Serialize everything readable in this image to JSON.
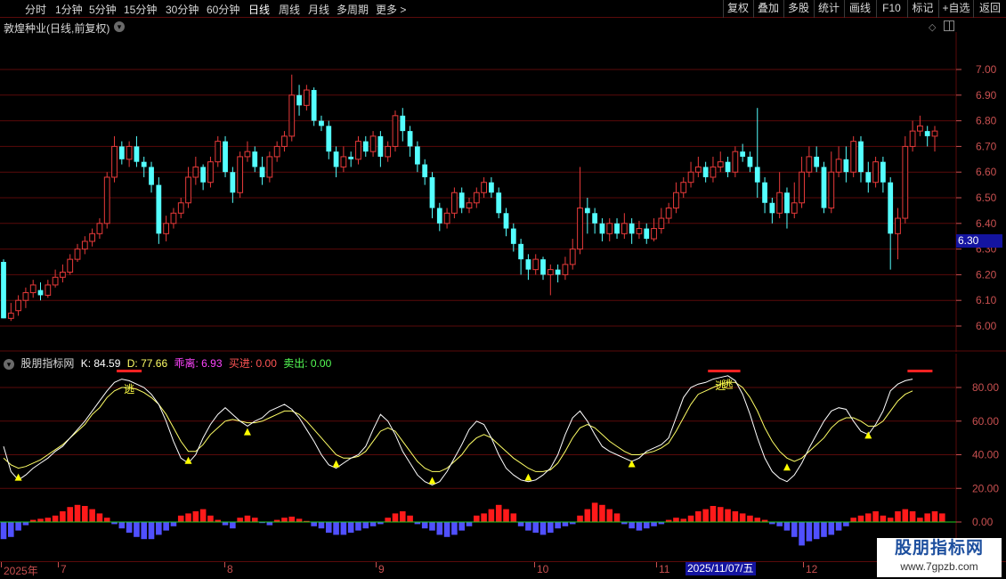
{
  "toolbar": {
    "periods": [
      "分时",
      "1分钟",
      "5分钟",
      "15分钟",
      "30分钟",
      "60分钟",
      "日线",
      "周线",
      "月线",
      "多周期",
      "更多 >"
    ],
    "active_period": "日线",
    "right_buttons": [
      "复权",
      "叠加",
      "多股",
      "统计",
      "画线",
      "F10",
      "标记",
      "+自选",
      "返回"
    ]
  },
  "main": {
    "title": "敦煌种业(日线,前复权)",
    "y_ticks": [
      "7.00",
      "6.90",
      "6.80",
      "6.70",
      "6.60",
      "6.50",
      "6.40",
      "6.30",
      "6.20",
      "6.10",
      "6.00"
    ],
    "current_price": "6.30",
    "colors": {
      "up": "#e83a3a",
      "down": "#54ffff",
      "grid": "#5a0a0a",
      "axis_text": "#c85050"
    }
  },
  "indicator": {
    "name": "股朋指标网",
    "k_label": "K: 84.59",
    "d_label": "D: 77.66",
    "deviation_label": "乖离: 6.93",
    "buy_label": "买进: 0.00",
    "sell_label": "卖出: 0.00",
    "escape_label": "逃",
    "y_ticks": [
      "80.00",
      "60.00",
      "40.00",
      "20.00",
      "0.00"
    ]
  },
  "date_axis": {
    "labels": [
      "2025年",
      "7",
      "8",
      "9",
      "10",
      "11",
      "12"
    ],
    "highlight": "2025/11/07/五"
  },
  "watermark": {
    "title": "股朋指标网",
    "url": "www.7gpzb.com"
  },
  "chart_data": {
    "type": "candlestick",
    "price_ylim": [
      6.0,
      7.0
    ],
    "indicator_ylim": [
      0,
      80
    ],
    "candles": [
      [
        6.25,
        6.03,
        6.26,
        6.03
      ],
      [
        6.03,
        6.05,
        6.09,
        6.02
      ],
      [
        6.06,
        6.1,
        6.12,
        6.04
      ],
      [
        6.1,
        6.13,
        6.15,
        6.07
      ],
      [
        6.13,
        6.16,
        6.18,
        6.11
      ],
      [
        6.14,
        6.12,
        6.17,
        6.1
      ],
      [
        6.12,
        6.16,
        6.18,
        6.11
      ],
      [
        6.16,
        6.19,
        6.22,
        6.15
      ],
      [
        6.19,
        6.21,
        6.24,
        6.17
      ],
      [
        6.21,
        6.26,
        6.28,
        6.2
      ],
      [
        6.26,
        6.3,
        6.32,
        6.25
      ],
      [
        6.3,
        6.33,
        6.35,
        6.28
      ],
      [
        6.33,
        6.36,
        6.38,
        6.31
      ],
      [
        6.36,
        6.4,
        6.42,
        6.34
      ],
      [
        6.4,
        6.58,
        6.6,
        6.38
      ],
      [
        6.58,
        6.7,
        6.74,
        6.56
      ],
      [
        6.7,
        6.65,
        6.72,
        6.63
      ],
      [
        6.65,
        6.7,
        6.72,
        6.62
      ],
      [
        6.7,
        6.64,
        6.74,
        6.62
      ],
      [
        6.64,
        6.62,
        6.66,
        6.58
      ],
      [
        6.62,
        6.55,
        6.64,
        6.52
      ],
      [
        6.55,
        6.36,
        6.58,
        6.32
      ],
      [
        6.36,
        6.4,
        6.43,
        6.33
      ],
      [
        6.4,
        6.44,
        6.46,
        6.38
      ],
      [
        6.44,
        6.48,
        6.5,
        6.42
      ],
      [
        6.48,
        6.58,
        6.62,
        6.46
      ],
      [
        6.58,
        6.62,
        6.66,
        6.55
      ],
      [
        6.62,
        6.56,
        6.63,
        6.53
      ],
      [
        6.56,
        6.64,
        6.66,
        6.54
      ],
      [
        6.64,
        6.72,
        6.74,
        6.62
      ],
      [
        6.72,
        6.6,
        6.74,
        6.58
      ],
      [
        6.6,
        6.52,
        6.62,
        6.48
      ],
      [
        6.52,
        6.66,
        6.68,
        6.5
      ],
      [
        6.66,
        6.68,
        6.72,
        6.64
      ],
      [
        6.68,
        6.62,
        6.7,
        6.6
      ],
      [
        6.62,
        6.58,
        6.66,
        6.55
      ],
      [
        6.58,
        6.66,
        6.68,
        6.56
      ],
      [
        6.66,
        6.7,
        6.72,
        6.64
      ],
      [
        6.7,
        6.74,
        6.76,
        6.68
      ],
      [
        6.74,
        6.9,
        6.98,
        6.72
      ],
      [
        6.9,
        6.86,
        6.94,
        6.82
      ],
      [
        6.86,
        6.92,
        6.94,
        6.84
      ],
      [
        6.92,
        6.8,
        6.93,
        6.78
      ],
      [
        6.8,
        6.78,
        6.82,
        6.76
      ],
      [
        6.78,
        6.68,
        6.8,
        6.65
      ],
      [
        6.68,
        6.62,
        6.7,
        6.58
      ],
      [
        6.62,
        6.66,
        6.7,
        6.6
      ],
      [
        6.66,
        6.65,
        6.68,
        6.62
      ],
      [
        6.65,
        6.72,
        6.74,
        6.63
      ],
      [
        6.72,
        6.68,
        6.74,
        6.66
      ],
      [
        6.68,
        6.74,
        6.76,
        6.66
      ],
      [
        6.74,
        6.66,
        6.76,
        6.62
      ],
      [
        6.66,
        6.7,
        6.72,
        6.64
      ],
      [
        6.7,
        6.82,
        6.84,
        6.68
      ],
      [
        6.82,
        6.76,
        6.85,
        6.72
      ],
      [
        6.76,
        6.7,
        6.78,
        6.66
      ],
      [
        6.7,
        6.63,
        6.72,
        6.6
      ],
      [
        6.63,
        6.58,
        6.65,
        6.55
      ],
      [
        6.58,
        6.46,
        6.6,
        6.42
      ],
      [
        6.46,
        6.4,
        6.48,
        6.37
      ],
      [
        6.4,
        6.44,
        6.46,
        6.38
      ],
      [
        6.44,
        6.52,
        6.54,
        6.42
      ],
      [
        6.52,
        6.46,
        6.54,
        6.44
      ],
      [
        6.46,
        6.48,
        6.5,
        6.44
      ],
      [
        6.48,
        6.52,
        6.54,
        6.46
      ],
      [
        6.52,
        6.56,
        6.58,
        6.5
      ],
      [
        6.56,
        6.52,
        6.58,
        6.5
      ],
      [
        6.52,
        6.44,
        6.54,
        6.42
      ],
      [
        6.44,
        6.38,
        6.46,
        6.35
      ],
      [
        6.38,
        6.32,
        6.4,
        6.29
      ],
      [
        6.32,
        6.26,
        6.34,
        6.2
      ],
      [
        6.26,
        6.22,
        6.28,
        6.18
      ],
      [
        6.22,
        6.26,
        6.28,
        6.2
      ],
      [
        6.26,
        6.2,
        6.27,
        6.18
      ],
      [
        6.2,
        6.22,
        6.24,
        6.12
      ],
      [
        6.22,
        6.2,
        6.24,
        6.17
      ],
      [
        6.2,
        6.24,
        6.27,
        6.18
      ],
      [
        6.24,
        6.3,
        6.34,
        6.22
      ],
      [
        6.3,
        6.46,
        6.62,
        6.28
      ],
      [
        6.46,
        6.44,
        6.5,
        6.36
      ],
      [
        6.44,
        6.4,
        6.46,
        6.36
      ],
      [
        6.4,
        6.36,
        6.42,
        6.33
      ],
      [
        6.36,
        6.4,
        6.42,
        6.33
      ],
      [
        6.4,
        6.36,
        6.42,
        6.34
      ],
      [
        6.36,
        6.4,
        6.44,
        6.34
      ],
      [
        6.4,
        6.36,
        6.42,
        6.32
      ],
      [
        6.36,
        6.38,
        6.41,
        6.34
      ],
      [
        6.38,
        6.34,
        6.4,
        6.32
      ],
      [
        6.34,
        6.38,
        6.42,
        6.33
      ],
      [
        6.38,
        6.42,
        6.46,
        6.36
      ],
      [
        6.42,
        6.46,
        6.48,
        6.4
      ],
      [
        6.46,
        6.52,
        6.56,
        6.44
      ],
      [
        6.52,
        6.56,
        6.58,
        6.5
      ],
      [
        6.56,
        6.6,
        6.64,
        6.54
      ],
      [
        6.6,
        6.62,
        6.66,
        6.58
      ],
      [
        6.62,
        6.58,
        6.64,
        6.56
      ],
      [
        6.58,
        6.62,
        6.66,
        6.56
      ],
      [
        6.62,
        6.64,
        6.68,
        6.6
      ],
      [
        6.64,
        6.6,
        6.66,
        6.58
      ],
      [
        6.6,
        6.68,
        6.7,
        6.58
      ],
      [
        6.68,
        6.66,
        6.71,
        6.64
      ],
      [
        6.66,
        6.62,
        6.68,
        6.6
      ],
      [
        6.62,
        6.56,
        6.85,
        6.5
      ],
      [
        6.56,
        6.48,
        6.58,
        6.44
      ],
      [
        6.48,
        6.44,
        6.5,
        6.4
      ],
      [
        6.44,
        6.52,
        6.6,
        6.42
      ],
      [
        6.52,
        6.44,
        6.54,
        6.38
      ],
      [
        6.44,
        6.48,
        6.56,
        6.42
      ],
      [
        6.48,
        6.6,
        6.66,
        6.46
      ],
      [
        6.6,
        6.66,
        6.7,
        6.58
      ],
      [
        6.66,
        6.62,
        6.7,
        6.6
      ],
      [
        6.62,
        6.46,
        6.64,
        6.44
      ],
      [
        6.46,
        6.6,
        6.68,
        6.44
      ],
      [
        6.6,
        6.65,
        6.7,
        6.58
      ],
      [
        6.65,
        6.6,
        6.7,
        6.56
      ],
      [
        6.6,
        6.72,
        6.74,
        6.58
      ],
      [
        6.72,
        6.6,
        6.74,
        6.56
      ],
      [
        6.6,
        6.56,
        6.64,
        6.52
      ],
      [
        6.56,
        6.64,
        6.66,
        6.54
      ],
      [
        6.64,
        6.56,
        6.66,
        6.52
      ],
      [
        6.56,
        6.36,
        6.58,
        6.22
      ],
      [
        6.36,
        6.42,
        6.46,
        6.26
      ],
      [
        6.42,
        6.7,
        6.74,
        6.4
      ],
      [
        6.7,
        6.76,
        6.8,
        6.68
      ],
      [
        6.76,
        6.78,
        6.82,
        6.74
      ],
      [
        6.76,
        6.74,
        6.78,
        6.7
      ],
      [
        6.74,
        6.76,
        6.78,
        6.68
      ]
    ],
    "k": [
      45,
      30,
      25,
      28,
      32,
      35,
      38,
      42,
      45,
      50,
      55,
      60,
      66,
      72,
      78,
      83,
      85,
      84,
      82,
      80,
      76,
      70,
      60,
      48,
      38,
      35,
      40,
      50,
      58,
      64,
      68,
      64,
      60,
      57,
      60,
      62,
      66,
      68,
      70,
      67,
      62,
      55,
      48,
      40,
      34,
      32,
      35,
      38,
      40,
      45,
      55,
      64,
      60,
      52,
      42,
      35,
      28,
      24,
      22,
      24,
      30,
      38,
      46,
      55,
      60,
      58,
      50,
      40,
      32,
      28,
      25,
      24,
      25,
      28,
      32,
      40,
      52,
      62,
      66,
      60,
      52,
      45,
      42,
      40,
      38,
      36,
      38,
      42,
      44,
      46,
      50,
      62,
      74,
      80,
      82,
      83,
      85,
      86,
      87,
      84,
      76,
      64,
      50,
      38,
      30,
      26,
      24,
      28,
      35,
      44,
      52,
      60,
      66,
      68,
      67,
      60,
      54,
      52,
      58,
      66,
      78,
      82,
      84,
      85
    ],
    "d": [
      38,
      34,
      32,
      33,
      35,
      37,
      40,
      43,
      46,
      50,
      54,
      58,
      64,
      68,
      74,
      78,
      80,
      80,
      79,
      77,
      74,
      70,
      64,
      56,
      48,
      42,
      42,
      46,
      52,
      56,
      60,
      61,
      60,
      59,
      59,
      60,
      62,
      64,
      66,
      66,
      64,
      60,
      55,
      50,
      45,
      40,
      38,
      38,
      39,
      42,
      48,
      54,
      56,
      54,
      48,
      42,
      36,
      32,
      30,
      30,
      32,
      36,
      40,
      46,
      50,
      52,
      50,
      46,
      42,
      38,
      35,
      32,
      30,
      30,
      31,
      35,
      42,
      50,
      56,
      58,
      56,
      52,
      48,
      45,
      42,
      40,
      40,
      41,
      42,
      44,
      47,
      54,
      62,
      70,
      76,
      78,
      80,
      82,
      83,
      83,
      80,
      74,
      66,
      56,
      48,
      42,
      38,
      36,
      38,
      42,
      46,
      50,
      56,
      60,
      62,
      62,
      60,
      57,
      57,
      60,
      66,
      72,
      76,
      78
    ],
    "macd": [
      -16,
      -14,
      -8,
      -3,
      2,
      3,
      4,
      6,
      10,
      14,
      16,
      15,
      12,
      8,
      4,
      -2,
      -6,
      -10,
      -14,
      -16,
      -16,
      -12,
      -8,
      -4,
      6,
      8,
      10,
      12,
      6,
      2,
      -3,
      -6,
      4,
      6,
      4,
      -1,
      -3,
      2,
      4,
      5,
      3,
      1,
      -4,
      -6,
      -10,
      -12,
      -12,
      -10,
      -8,
      -6,
      -4,
      -2,
      4,
      8,
      10,
      6,
      -2,
      -6,
      -8,
      -12,
      -14,
      -12,
      -8,
      -4,
      6,
      8,
      12,
      16,
      12,
      8,
      -4,
      -8,
      -10,
      -12,
      -10,
      -6,
      -4,
      -2,
      6,
      12,
      18,
      16,
      12,
      8,
      -2,
      -6,
      -8,
      -6,
      -4,
      -2,
      2,
      4,
      3,
      6,
      10,
      12,
      15,
      14,
      12,
      10,
      8,
      6,
      4,
      2,
      -2,
      -4,
      -8,
      -14,
      -22,
      -18,
      -16,
      -14,
      -12,
      -8,
      -4,
      4,
      6,
      8,
      10,
      6,
      4,
      10,
      12,
      10,
      4,
      8,
      10,
      8
    ]
  }
}
